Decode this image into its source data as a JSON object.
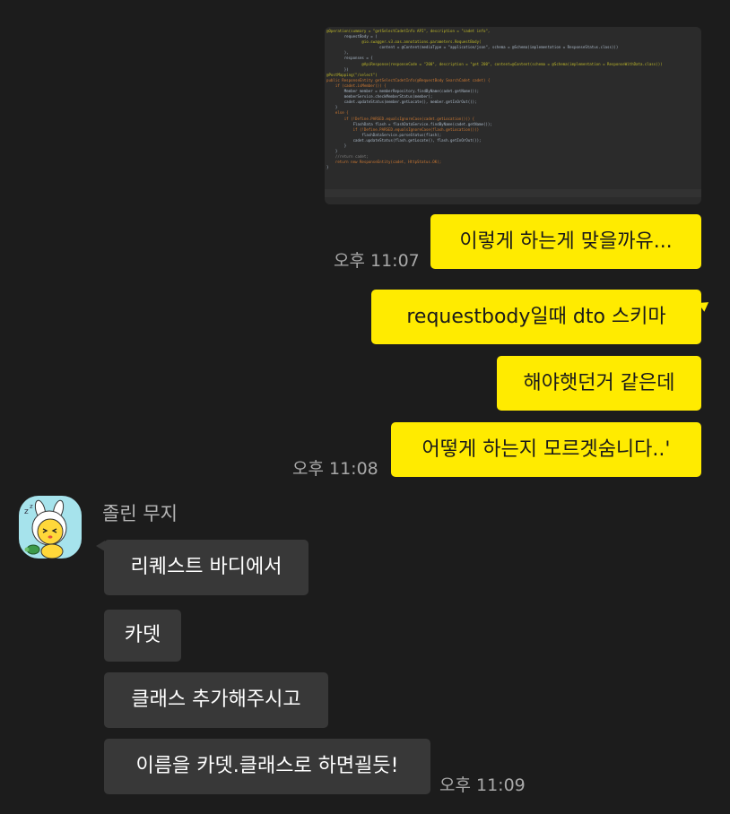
{
  "messages": {
    "me": [
      {
        "text": "이렇게 하는게 맞을까유..."
      },
      {
        "text": "requestbody일때 dto 스키마"
      },
      {
        "text": "해야햇던거 같은데"
      },
      {
        "text": "어떻게 하는지 모르겟숨니다..'"
      }
    ],
    "me_times": [
      "오후 11:07",
      "오후 11:08"
    ],
    "other_sender": "졸린 무지",
    "other": [
      {
        "text": "리퀘스트 바디에서"
      },
      {
        "text": "카뎃"
      },
      {
        "text": "클래스 추가해주시고"
      },
      {
        "text": "이름을 카뎃.클래스로 하면괼듯!"
      }
    ],
    "other_time": "오후 11:09"
  },
  "code_image": {
    "lines": [
      "@Operation(summary = \"getSelectCadetInfo API\", description = \"cadet info\",",
      "        requestBody = (",
      "                @io.swagger.v3.oas.annotations.parameters.RequestBody(",
      "                        content = @Content(mediaType = \"application/json\", schema = @Schema(implementation = ResponseStatus.class)))",
      "        ),",
      "        responses = {",
      "                @ApiResponse(responseCode = \"200\", description = \"get 200\", content=@Content(schema = @Schema(implementation = ResponseWithData.class)))",
      "        })",
      "@PostMapping(\"/select\")",
      "public ResponseEntity getSelectCadetInfo(@RequestBody SearchCadet cadet) {",
      "    if (cadet.isMember()) {",
      "        Member member = memberRepository.findByName(cadet.getName());",
      "        memberService.checkMemberStatus(member);",
      "        cadet.updateStatus(member.getLocate(), member.getInOrOut());",
      "    }",
      "    else {",
      "        if (!Define.PARSED.equalsIgnoreCase(cadet.getLocation())) {",
      "            FlashData flash = flashDataService.findByName(cadet.getName());",
      "            if (!Define.PARSED.equalsIgnoreCase(flash.getLocation()))",
      "                flashDataService.parseStatus(flash);",
      "            cadet.updateStatus(flash.getLocate(), flash.getInOrOut());",
      "        }",
      "    }",
      "    //return cadet;",
      "    return new ResponseEntity(cadet, HttpStatus.OK);",
      "}"
    ]
  }
}
